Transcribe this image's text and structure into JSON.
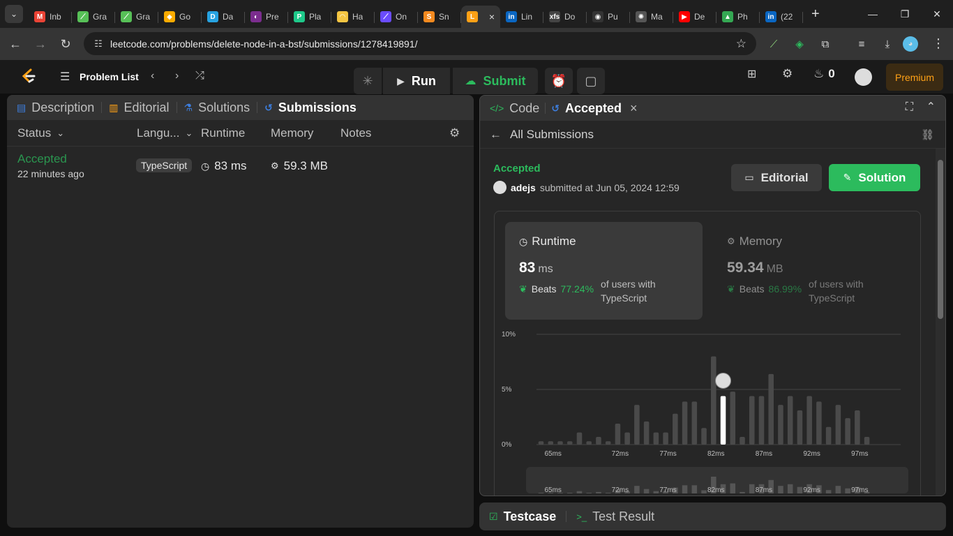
{
  "browser": {
    "tabs": [
      {
        "title": "Inb",
        "fav": "M",
        "color": "#ea4335"
      },
      {
        "title": "Gra",
        "fav": "⟋",
        "color": "#57c057"
      },
      {
        "title": "Gra",
        "fav": "⟋",
        "color": "#57c057"
      },
      {
        "title": "Go",
        "fav": "◆",
        "color": "#f9ab00"
      },
      {
        "title": "Da",
        "fav": "D",
        "color": "#27a2e0"
      },
      {
        "title": "Pre",
        "fav": "◐",
        "color": "#7b2d8e"
      },
      {
        "title": "Pla",
        "fav": "P",
        "color": "#1ec98a"
      },
      {
        "title": "Ha",
        "fav": "◠",
        "color": "#f4c542"
      },
      {
        "title": "On",
        "fav": "⟋",
        "color": "#6a4cff"
      },
      {
        "title": "Sn",
        "fav": "S",
        "color": "#f58a1f"
      },
      {
        "title": "",
        "fav": "L",
        "color": "#ffa116",
        "active": true
      },
      {
        "title": "Lin",
        "fav": "in",
        "color": "#0a66c2"
      },
      {
        "title": "Do",
        "fav": "xfs",
        "color": "#444444"
      },
      {
        "title": "Pu",
        "fav": "◉",
        "color": "#333333"
      },
      {
        "title": "Ma",
        "fav": "✺",
        "color": "#555555"
      },
      {
        "title": "De",
        "fav": "▶",
        "color": "#ff0000"
      },
      {
        "title": "Ph",
        "fav": "▲",
        "color": "#34a853"
      },
      {
        "title": "(22",
        "fav": "in",
        "color": "#0a66c2"
      }
    ],
    "active_tab_close": "×",
    "new_tab": "+",
    "url": "leetcode.com/problems/delete-node-in-a-bst/submissions/1278419891/"
  },
  "header": {
    "problem_list": "Problem List",
    "run": "Run",
    "submit": "Submit",
    "streak": "0",
    "premium": "Premium"
  },
  "left_panel": {
    "tabs": [
      "Description",
      "Editorial",
      "Solutions",
      "Submissions"
    ],
    "columns": {
      "status": "Status",
      "language": "Langu...",
      "runtime": "Runtime",
      "memory": "Memory",
      "notes": "Notes"
    },
    "rows": [
      {
        "status": "Accepted",
        "time": "22 minutes ago",
        "language": "TypeScript",
        "runtime": "83 ms",
        "memory": "59.3 MB"
      }
    ]
  },
  "right_panel": {
    "tabs": {
      "code": "Code",
      "accepted": "Accepted",
      "close": "×"
    },
    "back": "All Submissions",
    "status": "Accepted",
    "user": "adejs",
    "submitted_text": "submitted at Jun 05, 2024 12:59",
    "editorial_btn": "Editorial",
    "solution_btn": "Solution",
    "runtime": {
      "title": "Runtime",
      "value": "83",
      "unit": "ms",
      "beats_label": "Beats",
      "beats_pct": "77.24%",
      "suffix": "of users with TypeScript"
    },
    "memory": {
      "title": "Memory",
      "value": "59.34",
      "unit": "MB",
      "beats_label": "Beats",
      "beats_pct": "86.99%",
      "suffix": "of users with TypeScript"
    }
  },
  "bottom_panel": {
    "testcase": "Testcase",
    "test_result": "Test Result"
  },
  "colors": {
    "accent_green": "#2cbb5d",
    "accent_orange": "#ffa116",
    "panel_bg": "#262626",
    "tab_bg": "#333333"
  },
  "chart_data": {
    "type": "bar",
    "title": "",
    "xlabel": "",
    "ylabel": "",
    "yticks": [
      "10%",
      "5%",
      "0%"
    ],
    "ylim": [
      0,
      10
    ],
    "xticks": [
      "65ms",
      "72ms",
      "77ms",
      "82ms",
      "87ms",
      "92ms",
      "97ms"
    ],
    "categories": [
      "64ms",
      "65ms",
      "66ms",
      "67ms",
      "68ms",
      "69ms",
      "70ms",
      "71ms",
      "72ms",
      "73ms",
      "74ms",
      "75ms",
      "76ms",
      "77ms",
      "78ms",
      "79ms",
      "80ms",
      "81ms",
      "82ms",
      "83ms",
      "84ms",
      "85ms",
      "86ms",
      "87ms",
      "88ms",
      "89ms",
      "90ms",
      "91ms",
      "92ms",
      "93ms",
      "94ms",
      "95ms",
      "96ms",
      "97ms",
      "98ms",
      "99ms",
      "100ms",
      "101ms"
    ],
    "values": [
      0.3,
      0.3,
      0.3,
      0.3,
      1.1,
      0.3,
      0.7,
      0.3,
      1.9,
      1.1,
      3.6,
      2.1,
      1.1,
      1.1,
      2.8,
      3.9,
      3.9,
      1.5,
      8.0,
      4.4,
      4.8,
      0.7,
      4.4,
      4.4,
      6.4,
      3.6,
      4.4,
      3.1,
      4.4,
      3.9,
      1.6,
      3.6,
      2.4,
      3.1,
      0.7,
      0.0,
      0.0,
      0.0
    ],
    "highlight_category": "83ms",
    "grid": true
  }
}
